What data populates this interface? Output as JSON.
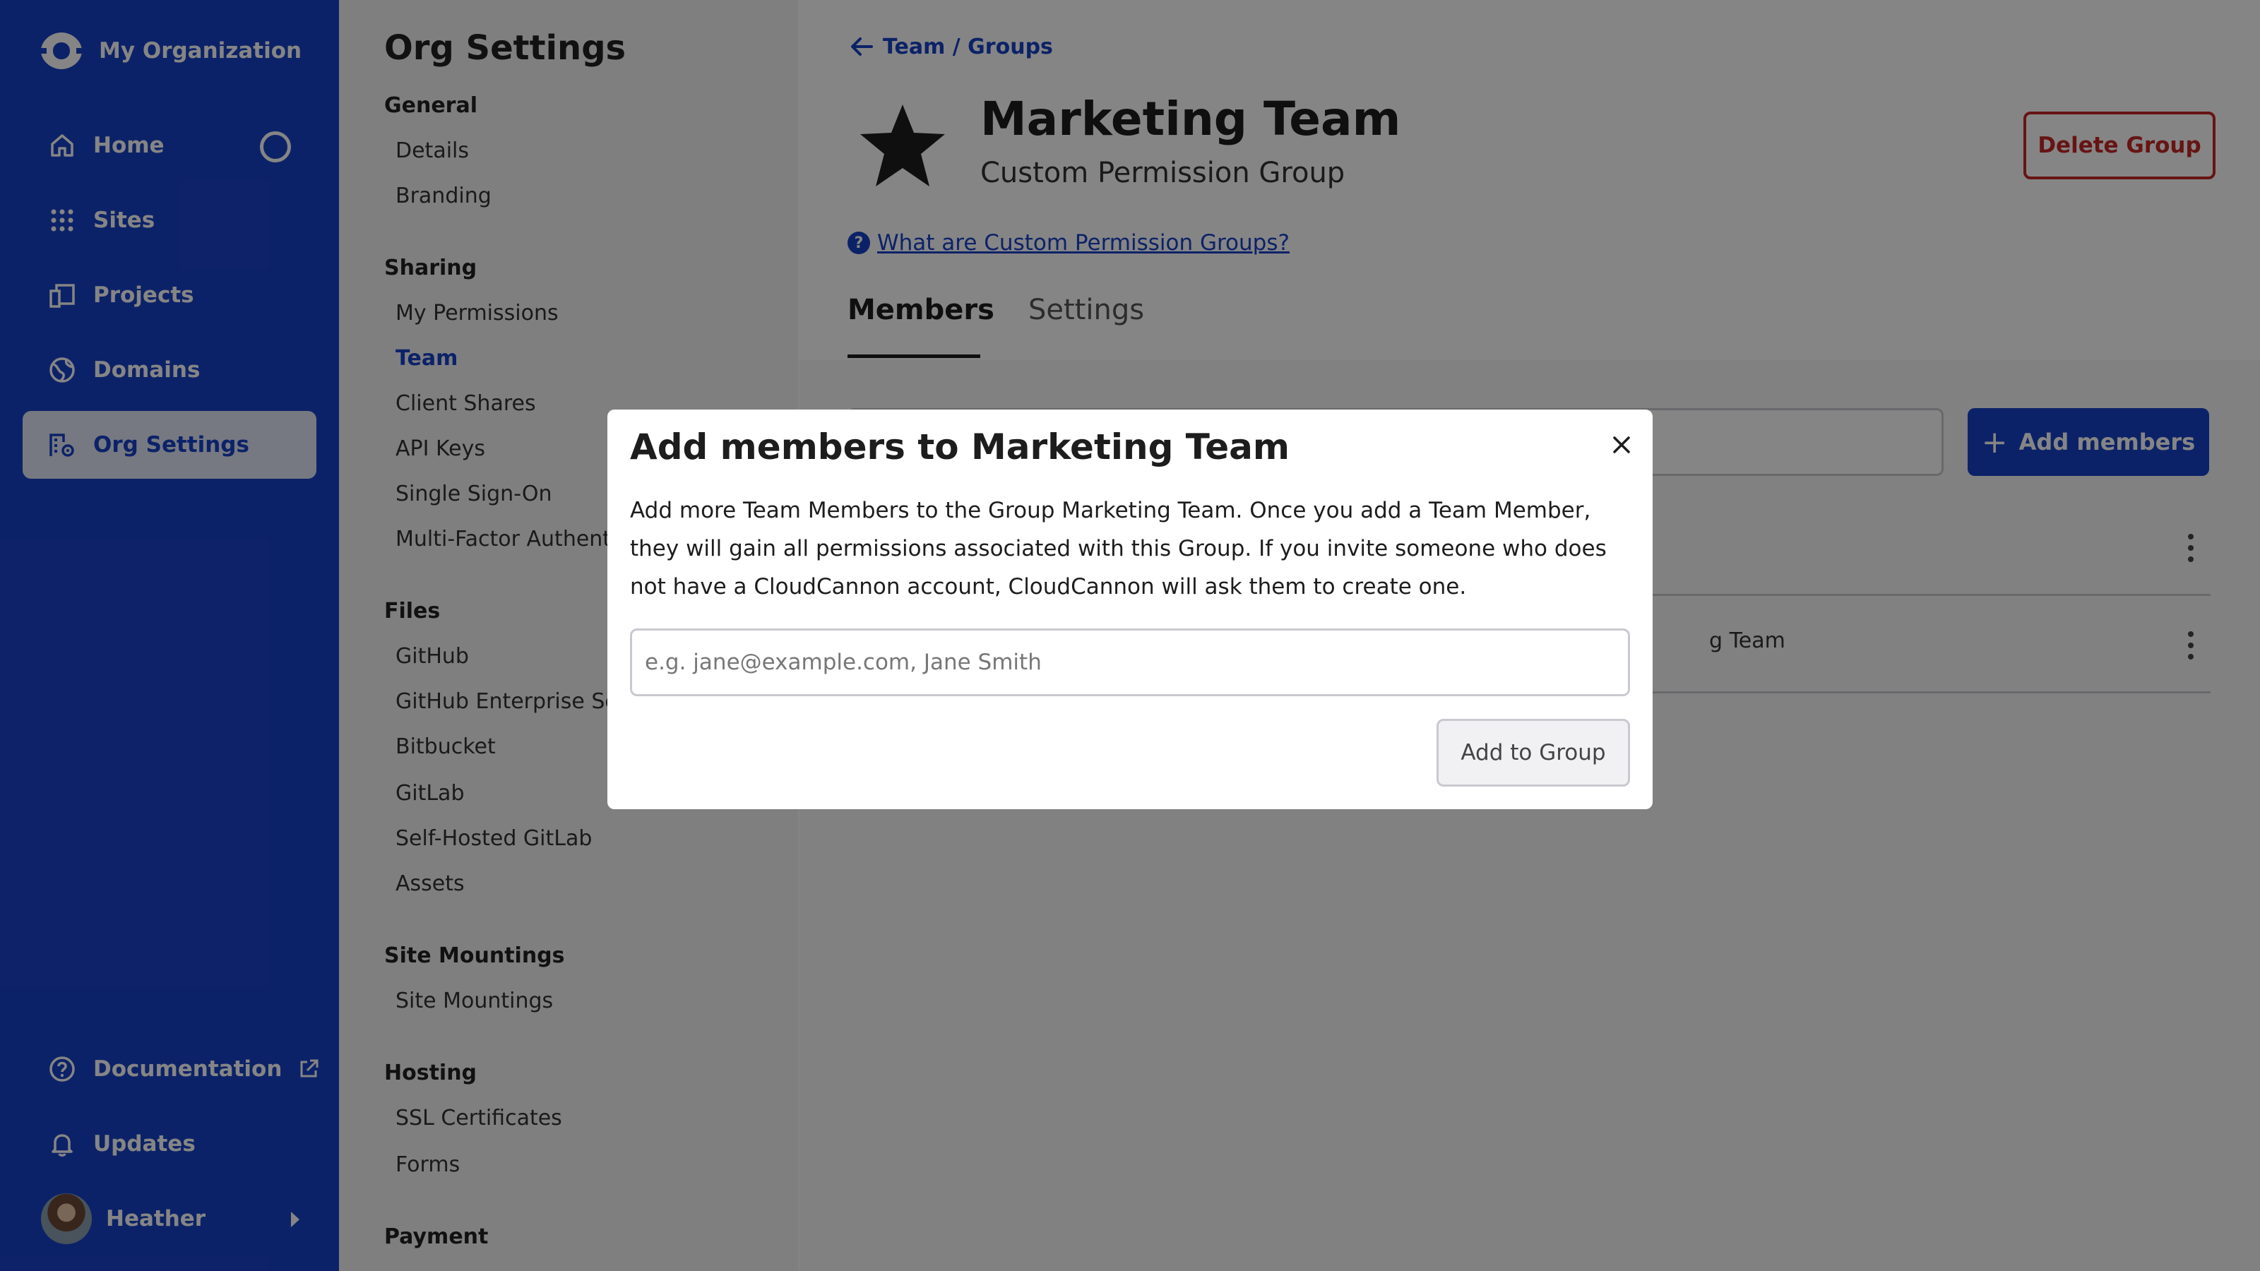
{
  "org": {
    "name": "My Organization"
  },
  "nav": {
    "items": [
      {
        "label": "Home",
        "icon": "home-icon"
      },
      {
        "label": "Sites",
        "icon": "grid-icon"
      },
      {
        "label": "Projects",
        "icon": "projects-icon"
      },
      {
        "label": "Domains",
        "icon": "globe-icon"
      },
      {
        "label": "Org Settings",
        "icon": "org-settings-icon"
      }
    ],
    "bottom": [
      {
        "label": "Documentation",
        "icon": "help-circle-icon"
      },
      {
        "label": "Updates",
        "icon": "bell-icon"
      }
    ],
    "user": {
      "name": "Heather"
    }
  },
  "settings": {
    "title": "Org Settings",
    "sections": [
      {
        "heading": "General",
        "items": [
          "Details",
          "Branding"
        ]
      },
      {
        "heading": "Sharing",
        "items": [
          "My Permissions",
          "Team",
          "Client Shares",
          "API Keys",
          "Single Sign-On",
          "Multi-Factor Authent"
        ]
      },
      {
        "heading": "Files",
        "items": [
          "GitHub",
          "GitHub Enterprise Se",
          "Bitbucket",
          "GitLab",
          "Self-Hosted GitLab",
          "Assets"
        ]
      },
      {
        "heading": "Site Mountings",
        "items": [
          "Site Mountings"
        ]
      },
      {
        "heading": "Hosting",
        "items": [
          "SSL Certificates",
          "Forms"
        ]
      },
      {
        "heading": "Payment",
        "items": []
      }
    ],
    "active_item": "Team"
  },
  "main": {
    "breadcrumb": "Team / Groups",
    "group_title": "Marketing Team",
    "group_subtitle": "Custom Permission Group",
    "help_link": "What are Custom Permission Groups?",
    "delete_label": "Delete Group",
    "tabs": [
      {
        "label": "Members",
        "active": true
      },
      {
        "label": "Settings",
        "active": false
      }
    ],
    "add_members_label": "Add members",
    "rows": [
      {
        "text": ""
      },
      {
        "text": "g Team"
      }
    ]
  },
  "modal": {
    "title": "Add members to Marketing Team",
    "description": "Add more Team Members to the Group Marketing Team. Once you add a Team Member, they will gain all permissions associated with this Group. If you invite someone who does not have a CloudCannon account, CloudCannon will ask them to create one.",
    "input_placeholder": "e.g. jane@example.com, Jane Smith",
    "input_value": "",
    "submit_label": "Add to Group",
    "close_icon": "close-icon"
  },
  "colors": {
    "brand": "#1841c8",
    "danger": "#c62828",
    "overlay": "rgba(0,0,0,0.48)"
  }
}
